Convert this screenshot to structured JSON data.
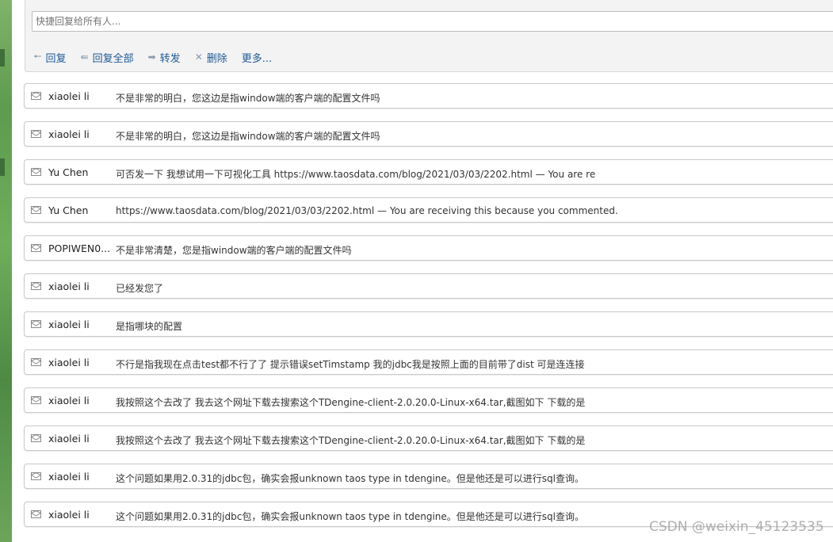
{
  "reply": {
    "placeholder": "快捷回复给所有人...",
    "actions": [
      {
        "icon": "reply-arrow-icon",
        "glyph": "🠔",
        "label": "回复"
      },
      {
        "icon": "reply-all-icon",
        "glyph": "⇚",
        "label": "回复全部"
      },
      {
        "icon": "forward-arrow-icon",
        "glyph": "➡",
        "label": "转发"
      },
      {
        "icon": "delete-x-icon",
        "glyph": "✕",
        "label": "删除"
      },
      {
        "icon": "",
        "glyph": "",
        "label": "更多..."
      }
    ]
  },
  "messages": [
    {
      "sender": "xiaolei li",
      "subject": "不是非常的明白，您这边是指window端的客户端的配置文件吗"
    },
    {
      "sender": "xiaolei li",
      "subject": "不是非常的明白，您这边是指window端的客户端的配置文件吗"
    },
    {
      "sender": "Yu Chen",
      "subject": "可否发一下 我想试用一下可视化工具 https://www.taosdata.com/blog/2021/03/03/2202.html — You are re"
    },
    {
      "sender": "Yu Chen",
      "subject": "https://www.taosdata.com/blog/2021/03/03/2202.html — You are receiving this because you commented."
    },
    {
      "sender": "POPIWEN0...",
      "subject": "不是非常清楚，您是指window端的客户端的配置文件吗"
    },
    {
      "sender": "xiaolei li",
      "subject": "已经发您了"
    },
    {
      "sender": "xiaolei li",
      "subject": "是指哪块的配置"
    },
    {
      "sender": "xiaolei li",
      "subject": "不行是指我现在点击test都不行了了 提示错误setTimstamp 我的jdbc我是按照上面的目前带了dist 可是连连接"
    },
    {
      "sender": "xiaolei li",
      "subject": "我按照这个去改了 我去这个网址下载去搜索这个TDengine-client-2.0.20.0-Linux-x64.tar,截图如下 下载的是"
    },
    {
      "sender": "xiaolei li",
      "subject": "我按照这个去改了 我去这个网址下载去搜索这个TDengine-client-2.0.20.0-Linux-x64.tar,截图如下 下载的是"
    },
    {
      "sender": "xiaolei li",
      "subject": "这个问题如果用2.0.31的jdbc包，确实会报unknown taos type in tdengine。但是他还是可以进行sql查询。"
    },
    {
      "sender": "xiaolei li",
      "subject": "这个问题如果用2.0.31的jdbc包，确实会报unknown taos type in tdengine。但是他还是可以进行sql查询。"
    }
  ],
  "watermark": "CSDN @weixin_45123535",
  "colors": {
    "link": "#1f5a95",
    "border": "#c9c9c9"
  }
}
